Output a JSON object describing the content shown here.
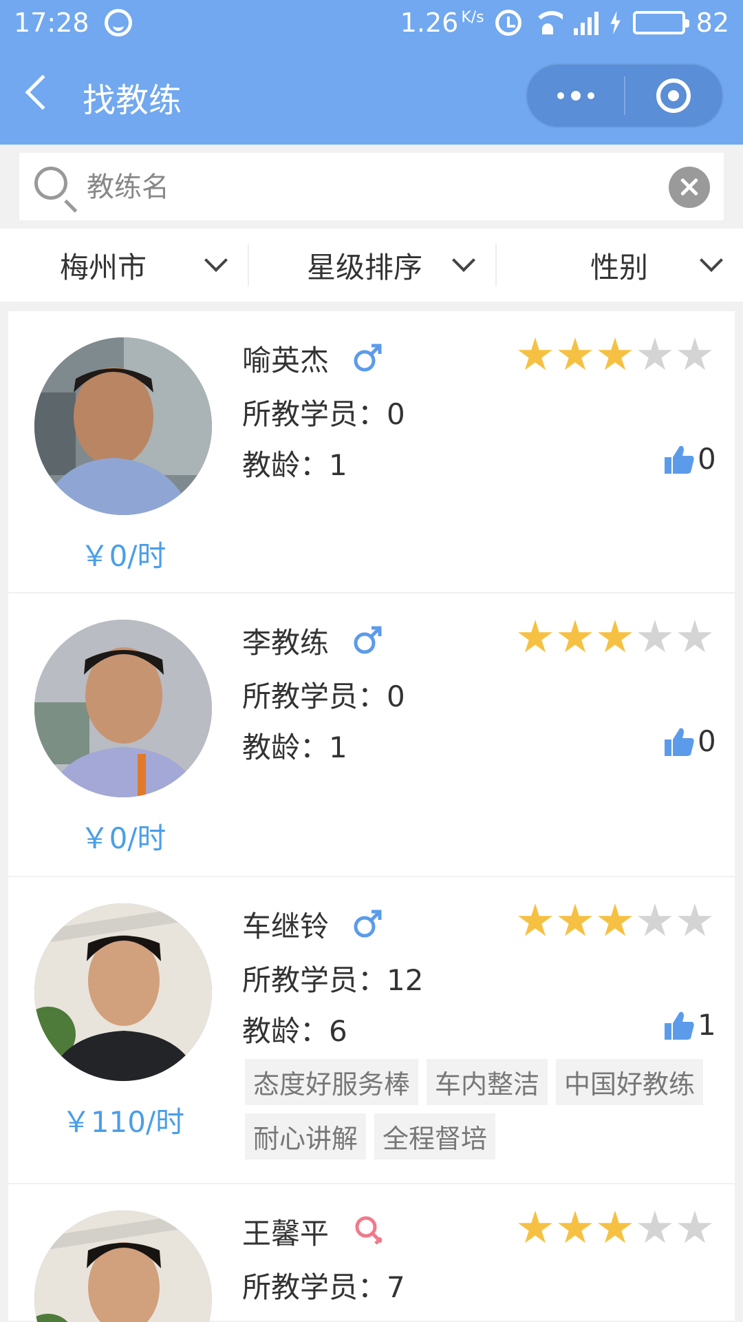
{
  "status_bar": {
    "time": "17:28",
    "speed": "1.26",
    "speed_unit": "K/s",
    "network": "4G",
    "battery": "82",
    "battery_level": 0.82
  },
  "nav": {
    "title": "找教练"
  },
  "search": {
    "placeholder": "教练名",
    "value": ""
  },
  "filters": [
    {
      "label": "梅州市"
    },
    {
      "label": "星级排序"
    },
    {
      "label": "性别"
    }
  ],
  "labels": {
    "students_prefix": "所教学员：",
    "years_prefix": "教龄："
  },
  "colors": {
    "header": "#71a8ef",
    "price": "#4a9ee8",
    "star_on": "#f6c142",
    "star_off": "#d4d4d4",
    "male": "#5b9bea",
    "female": "#f07a8a"
  },
  "coaches": [
    {
      "name": "喻英杰",
      "gender": "male",
      "gender_icon": "male-icon",
      "rating": 3,
      "rating_max": 5,
      "students": "0",
      "years": "1",
      "likes": "0",
      "price": "￥0/时",
      "tags": []
    },
    {
      "name": "李教练",
      "gender": "male",
      "gender_icon": "male-icon",
      "rating": 3,
      "rating_max": 5,
      "students": "0",
      "years": "1",
      "likes": "0",
      "price": "￥0/时",
      "tags": []
    },
    {
      "name": "车继铃",
      "gender": "male",
      "gender_icon": "male-icon",
      "rating": 3,
      "rating_max": 5,
      "students": "12",
      "years": "6",
      "likes": "1",
      "price": "￥110/时",
      "tags": [
        "态度好服务棒",
        "车内整洁",
        "中国好教练",
        "耐心讲解",
        "全程督培"
      ]
    },
    {
      "name": "王馨平",
      "gender": "female",
      "gender_icon": "female-icon",
      "rating": 3,
      "rating_max": 5,
      "students": "7",
      "years": "",
      "likes": "",
      "price": "",
      "tags": []
    }
  ]
}
